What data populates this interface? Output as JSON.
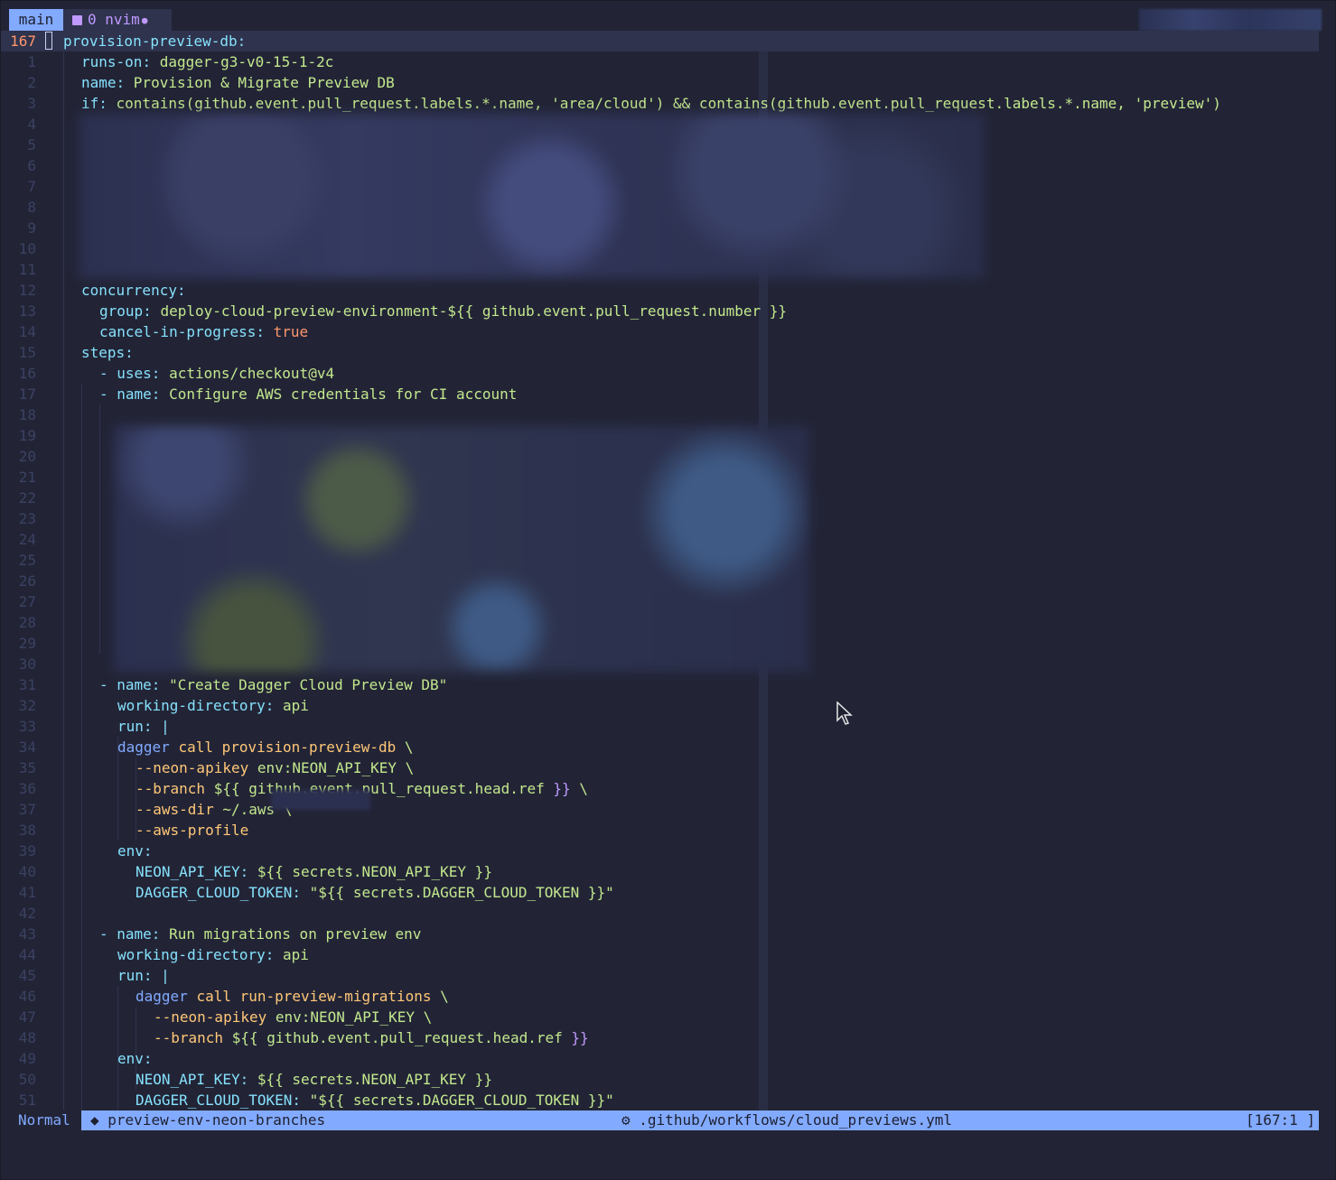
{
  "tmux": {
    "session": "main",
    "window_icon": "terminal-icon",
    "window_index": "0",
    "window_name": "nvim",
    "window_flag": "●"
  },
  "editor": {
    "current_line_number": "167",
    "lines": [
      {
        "n": "167",
        "parts": [
          [
            "k",
            "provision-preview-db"
          ],
          [
            "d",
            ":"
          ]
        ]
      },
      {
        "n": "1",
        "parts": [
          [
            "k",
            "runs-on"
          ],
          [
            "d",
            ": "
          ],
          [
            "v",
            "dagger-g3-v0-15-1-2c"
          ]
        ]
      },
      {
        "n": "2",
        "parts": [
          [
            "k",
            "name"
          ],
          [
            "d",
            ": "
          ],
          [
            "v",
            "Provision & Migrate Preview DB"
          ]
        ]
      },
      {
        "n": "3",
        "parts": [
          [
            "k",
            "if"
          ],
          [
            "d",
            ": "
          ],
          [
            "v",
            "contains(github.event.pull_request.labels.*.name, 'area/cloud') && contains(github.event.pull_request.labels.*.name, 'preview')"
          ]
        ]
      },
      {
        "n": "4",
        "parts": []
      },
      {
        "n": "5",
        "parts": []
      },
      {
        "n": "6",
        "parts": []
      },
      {
        "n": "7",
        "parts": []
      },
      {
        "n": "8",
        "parts": []
      },
      {
        "n": "9",
        "parts": []
      },
      {
        "n": "10",
        "parts": []
      },
      {
        "n": "11",
        "parts": []
      },
      {
        "n": "12",
        "parts": [
          [
            "k",
            "concurrency"
          ],
          [
            "d",
            ":"
          ]
        ]
      },
      {
        "n": "13",
        "parts": [
          [
            "k",
            "group"
          ],
          [
            "d",
            ": "
          ],
          [
            "v",
            "deploy-cloud-preview-environment-${{ github.event.pull_request.number }}"
          ]
        ]
      },
      {
        "n": "14",
        "parts": [
          [
            "k",
            "cancel-in-progress"
          ],
          [
            "d",
            ": "
          ],
          [
            "o",
            "true"
          ]
        ]
      },
      {
        "n": "15",
        "parts": [
          [
            "k",
            "steps"
          ],
          [
            "d",
            ":"
          ]
        ]
      },
      {
        "n": "16",
        "parts": [
          [
            "d",
            "- "
          ],
          [
            "k",
            "uses"
          ],
          [
            "d",
            ": "
          ],
          [
            "v",
            "actions/checkout@v4"
          ]
        ]
      },
      {
        "n": "17",
        "parts": [
          [
            "d",
            "- "
          ],
          [
            "k",
            "name"
          ],
          [
            "d",
            ": "
          ],
          [
            "v",
            "Configure AWS credentials for CI account"
          ]
        ]
      },
      {
        "n": "18",
        "parts": []
      },
      {
        "n": "19",
        "parts": []
      },
      {
        "n": "20",
        "parts": []
      },
      {
        "n": "21",
        "parts": []
      },
      {
        "n": "22",
        "parts": []
      },
      {
        "n": "23",
        "parts": []
      },
      {
        "n": "24",
        "parts": []
      },
      {
        "n": "25",
        "parts": []
      },
      {
        "n": "26",
        "parts": []
      },
      {
        "n": "27",
        "parts": []
      },
      {
        "n": "28",
        "parts": []
      },
      {
        "n": "29",
        "parts": []
      },
      {
        "n": "30",
        "parts": []
      },
      {
        "n": "31",
        "parts": [
          [
            "d",
            "- "
          ],
          [
            "k",
            "name"
          ],
          [
            "d",
            ": "
          ],
          [
            "v",
            "\"Create Dagger Cloud Preview DB\""
          ]
        ]
      },
      {
        "n": "32",
        "parts": [
          [
            "k",
            "working-directory"
          ],
          [
            "d",
            ": "
          ],
          [
            "v",
            "api"
          ]
        ]
      },
      {
        "n": "33",
        "parts": [
          [
            "k",
            "run"
          ],
          [
            "d",
            ": |"
          ]
        ]
      },
      {
        "n": "34",
        "parts": [
          [
            "c",
            "dagger"
          ],
          [
            "v",
            " "
          ],
          [
            "y",
            "call"
          ],
          [
            "v",
            " "
          ],
          [
            "y",
            "provision-preview-db"
          ],
          [
            "v",
            " \\"
          ]
        ]
      },
      {
        "n": "35",
        "parts": [
          [
            "y",
            "--neon-apikey"
          ],
          [
            "v",
            " env:NEON_API_KEY \\"
          ]
        ]
      },
      {
        "n": "36",
        "parts": [
          [
            "y",
            "--branch"
          ],
          [
            "v",
            " ${{ github.event.pull_request.head.ref "
          ],
          [
            "s",
            "}}"
          ],
          [
            "v",
            " \\"
          ]
        ]
      },
      {
        "n": "37",
        "parts": [
          [
            "y",
            "--aws-dir"
          ],
          [
            "v",
            " ~/.aws \\"
          ]
        ]
      },
      {
        "n": "38",
        "parts": [
          [
            "y",
            "--aws-profile"
          ]
        ]
      },
      {
        "n": "39",
        "parts": [
          [
            "k",
            "env"
          ],
          [
            "d",
            ":"
          ]
        ]
      },
      {
        "n": "40",
        "parts": [
          [
            "k",
            "NEON_API_KEY"
          ],
          [
            "d",
            ": "
          ],
          [
            "v",
            "${{ secrets.NEON_API_KEY }}"
          ]
        ]
      },
      {
        "n": "41",
        "parts": [
          [
            "k",
            "DAGGER_CLOUD_TOKEN"
          ],
          [
            "d",
            ": "
          ],
          [
            "v",
            "\"${{ secrets.DAGGER_CLOUD_TOKEN }}\""
          ]
        ]
      },
      {
        "n": "42",
        "parts": []
      },
      {
        "n": "43",
        "parts": [
          [
            "d",
            "- "
          ],
          [
            "k",
            "name"
          ],
          [
            "d",
            ": "
          ],
          [
            "v",
            "Run migrations on preview env"
          ]
        ]
      },
      {
        "n": "44",
        "parts": [
          [
            "k",
            "working-directory"
          ],
          [
            "d",
            ": "
          ],
          [
            "v",
            "api"
          ]
        ]
      },
      {
        "n": "45",
        "parts": [
          [
            "k",
            "run"
          ],
          [
            "d",
            ": |"
          ]
        ]
      },
      {
        "n": "46",
        "parts": [
          [
            "c",
            "dagger"
          ],
          [
            "v",
            " "
          ],
          [
            "y",
            "call"
          ],
          [
            "v",
            " "
          ],
          [
            "y",
            "run-preview-migrations"
          ],
          [
            "v",
            " \\"
          ]
        ]
      },
      {
        "n": "47",
        "parts": [
          [
            "y",
            "--neon-apikey"
          ],
          [
            "v",
            " env:NEON_API_KEY \\"
          ]
        ]
      },
      {
        "n": "48",
        "parts": [
          [
            "y",
            "--branch"
          ],
          [
            "v",
            " ${{ github.event.pull_request.head.ref "
          ],
          [
            "s",
            "}}"
          ]
        ]
      },
      {
        "n": "49",
        "parts": [
          [
            "k",
            "env"
          ],
          [
            "d",
            ":"
          ]
        ]
      },
      {
        "n": "50",
        "parts": [
          [
            "k",
            "NEON_API_KEY"
          ],
          [
            "d",
            ": "
          ],
          [
            "v",
            "${{ secrets.NEON_API_KEY }}"
          ]
        ]
      },
      {
        "n": "51",
        "parts": [
          [
            "k",
            "DAGGER_CLOUD_TOKEN"
          ],
          [
            "d",
            ": "
          ],
          [
            "v",
            "\"${{ secrets.DAGGER_CLOUD_TOKEN }}\""
          ]
        ]
      }
    ]
  },
  "statusline": {
    "mode": "Normal",
    "branch_icon": "git-branch-icon",
    "branch": "preview-env-neon-branches",
    "file_icon": "gear-icon",
    "file_path": ".github/workflows/cloud_previews.yml",
    "position": "[167:1 ]"
  },
  "colors": {
    "background": "#222436",
    "accent": "#82aaff",
    "key": "#86e1fc",
    "value": "#c3e88d",
    "boolean": "#ff966c",
    "flag": "#ffc777",
    "brace": "#c099ff"
  }
}
